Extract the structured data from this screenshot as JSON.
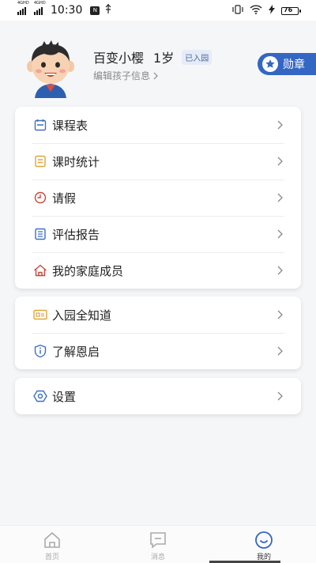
{
  "status_bar": {
    "time": "10:30",
    "signal1_label": "4GHD",
    "signal2_label": "4GHD",
    "notif_badge": "N",
    "battery_label": "76"
  },
  "profile": {
    "name": "百变小樱",
    "age": "1岁",
    "badge": "已入园",
    "edit_label": "编辑孩子信息",
    "medal_label": "勋章"
  },
  "menu_groups": [
    {
      "items": [
        {
          "label": "课程表",
          "icon": "calendar-icon"
        },
        {
          "label": "课时统计",
          "icon": "document-icon"
        },
        {
          "label": "请假",
          "icon": "clock-icon"
        },
        {
          "label": "评估报告",
          "icon": "report-icon"
        },
        {
          "label": "我的家庭成员",
          "icon": "home-icon"
        }
      ]
    },
    {
      "items": [
        {
          "label": "入园全知道",
          "icon": "id-card-icon"
        },
        {
          "label": "了解恩启",
          "icon": "info-shield-icon"
        }
      ]
    },
    {
      "items": [
        {
          "label": "设置",
          "icon": "settings-icon"
        }
      ]
    }
  ],
  "bottom_nav": {
    "tabs": [
      {
        "label": "首页",
        "icon": "home-icon"
      },
      {
        "label": "消息",
        "icon": "message-icon"
      },
      {
        "label": "我的",
        "icon": "profile-icon"
      }
    ],
    "active_tab": "我的"
  },
  "colors": {
    "accent": "#3466c4",
    "background": "#f5f6f8",
    "card": "#ffffff"
  }
}
